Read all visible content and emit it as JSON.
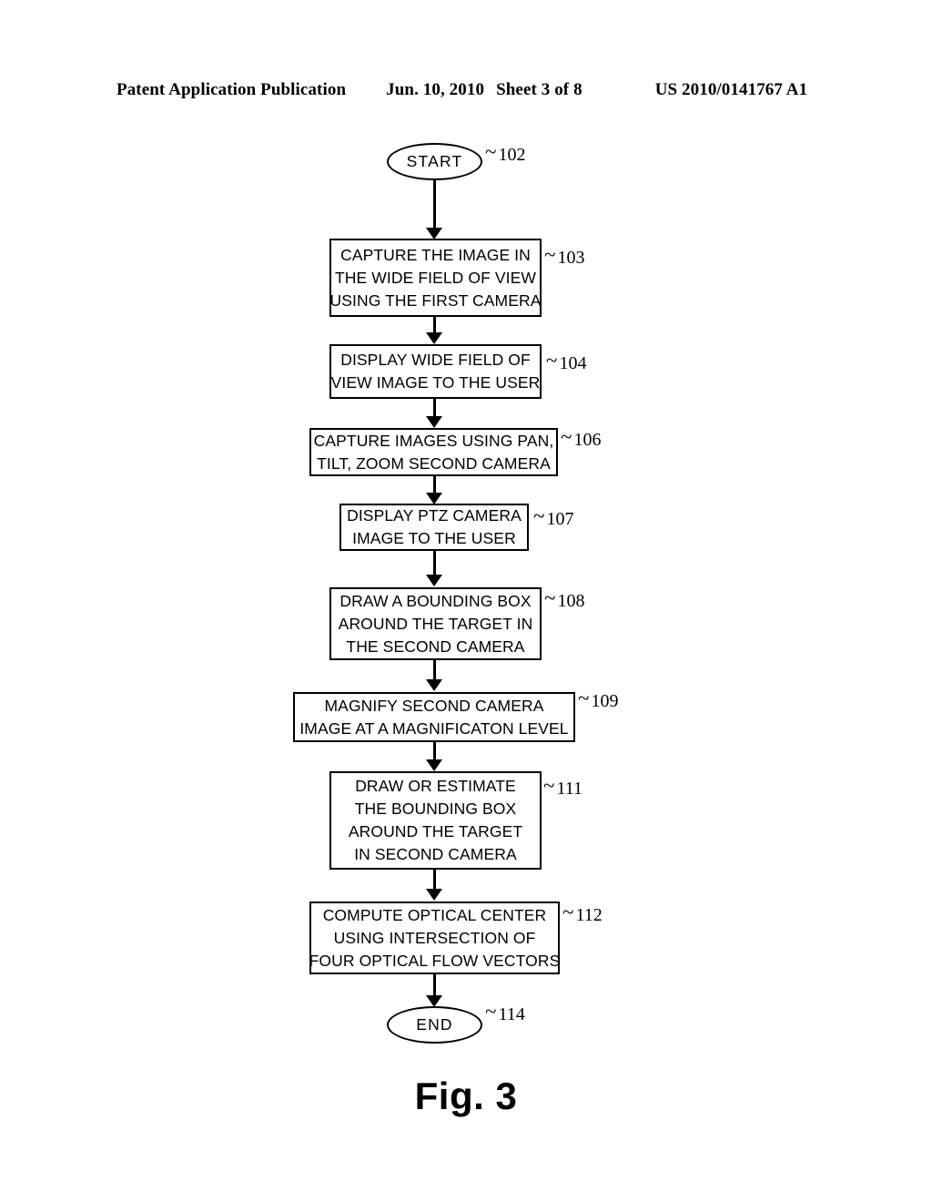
{
  "header": {
    "publication": "Patent Application Publication",
    "date": "Jun. 10, 2010",
    "sheet": "Sheet 3 of 8",
    "patent_number": "US 2010/0141767 A1"
  },
  "figure": {
    "caption": "Fig. 3",
    "type": "flowchart"
  },
  "flowchart": {
    "nodes": [
      {
        "id": "start",
        "shape": "oval",
        "ref": "102",
        "lines": [
          "START"
        ]
      },
      {
        "id": "step-103",
        "shape": "rect",
        "ref": "103",
        "lines": [
          "CAPTURE THE IMAGE IN",
          "THE WIDE FIELD OF VIEW",
          "USING THE FIRST CAMERA"
        ]
      },
      {
        "id": "step-104",
        "shape": "rect",
        "ref": "104",
        "lines": [
          "DISPLAY WIDE FIELD OF",
          "VIEW IMAGE TO THE USER"
        ]
      },
      {
        "id": "step-106",
        "shape": "rect",
        "ref": "106",
        "lines": [
          "CAPTURE IMAGES USING PAN,",
          "TILT, ZOOM SECOND CAMERA"
        ]
      },
      {
        "id": "step-107",
        "shape": "rect",
        "ref": "107",
        "lines": [
          "DISPLAY PTZ CAMERA",
          "IMAGE TO THE USER"
        ]
      },
      {
        "id": "step-108",
        "shape": "rect",
        "ref": "108",
        "lines": [
          "DRAW A BOUNDING BOX",
          "AROUND THE TARGET IN",
          "THE SECOND CAMERA"
        ]
      },
      {
        "id": "step-109",
        "shape": "rect",
        "ref": "109",
        "lines": [
          "MAGNIFY SECOND CAMERA",
          "IMAGE AT A MAGNIFICATON LEVEL"
        ]
      },
      {
        "id": "step-111",
        "shape": "rect",
        "ref": "111",
        "lines": [
          "DRAW OR ESTIMATE",
          "THE BOUNDING BOX",
          "AROUND THE TARGET",
          "IN SECOND CAMERA"
        ]
      },
      {
        "id": "step-112",
        "shape": "rect",
        "ref": "112",
        "lines": [
          "COMPUTE OPTICAL CENTER",
          "USING INTERSECTION OF",
          "FOUR OPTICAL FLOW VECTORS"
        ]
      },
      {
        "id": "end",
        "shape": "oval",
        "ref": "114",
        "lines": [
          "END"
        ]
      }
    ],
    "ref_marker_prefix": "~",
    "colors": {
      "stroke": "#000000",
      "fill": "#ffffff",
      "background": "#ffffff"
    }
  }
}
